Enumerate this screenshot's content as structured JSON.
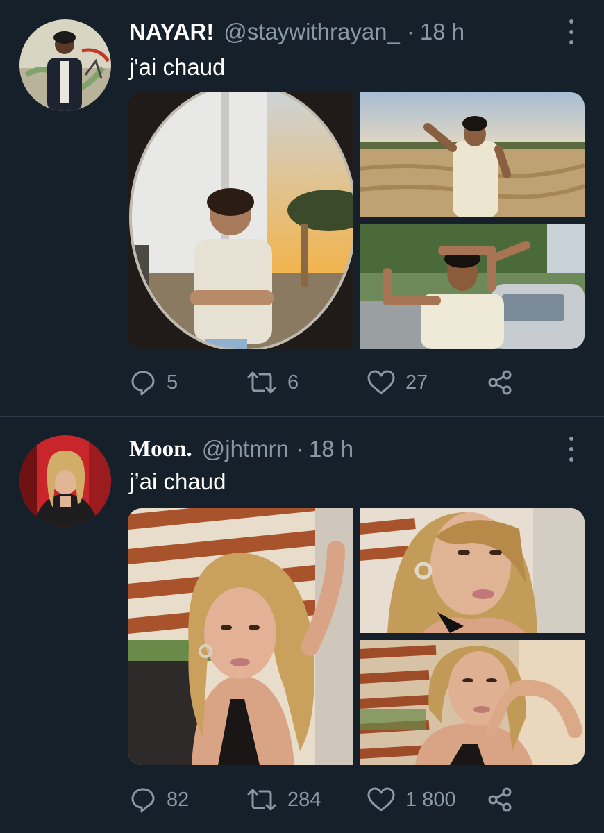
{
  "tweets": [
    {
      "name": "NAYAR!",
      "handle": "@staywithrayan_",
      "separator": "·",
      "time": "18 h",
      "text": "j'ai chaud",
      "stats": {
        "replies": "5",
        "retweets": "6",
        "likes": "27"
      }
    },
    {
      "name": "Moon.",
      "handle": "@jhtmrn",
      "separator": "·",
      "time": "18 h",
      "text": "j’ai chaud",
      "stats": {
        "replies": "82",
        "retweets": "284",
        "likes": "1 800"
      }
    }
  ],
  "icons": {
    "reply": "reply-icon",
    "retweet": "retweet-icon",
    "like": "heart-icon",
    "share": "share-icon",
    "more": "more-icon"
  },
  "colors": {
    "background": "#15202b",
    "secondary_text": "#8b98a5",
    "divider": "#2f3b48"
  }
}
